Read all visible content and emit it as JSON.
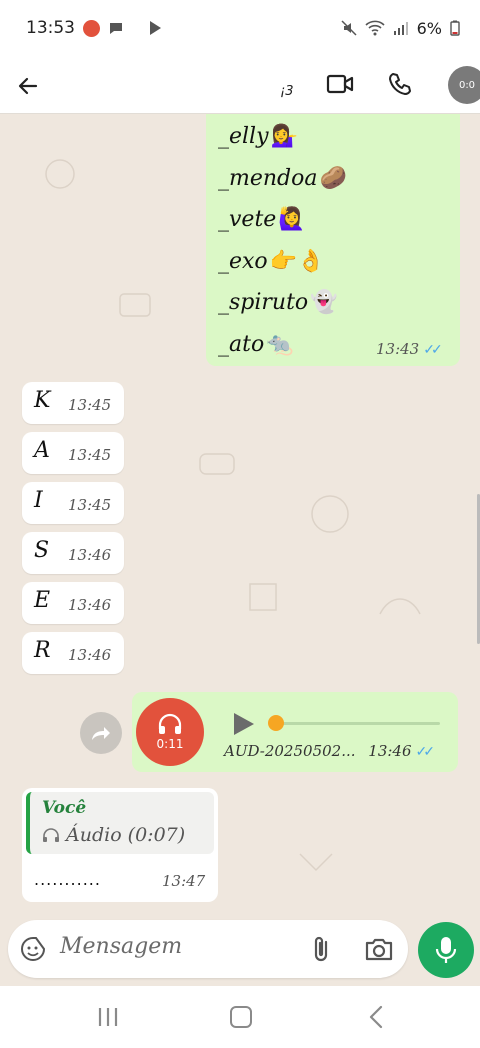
{
  "status_bar": {
    "time": "13:53",
    "battery": "6%"
  },
  "header": {
    "subtitle": "¡3",
    "call_timer": "0:0"
  },
  "messages": {
    "outgoing_list": {
      "lines": [
        {
          "text": "_elly",
          "emoji": "💁‍♀️"
        },
        {
          "text": "_mendoa",
          "emoji": "🥔"
        },
        {
          "text": "_vete",
          "emoji": "🙋‍♀️"
        },
        {
          "text": "_exo",
          "emoji": "👉👌"
        },
        {
          "text": "_spiruto",
          "emoji": "👻"
        },
        {
          "text": "_ato",
          "emoji": "🐀"
        }
      ],
      "time": "13:43",
      "ticks": "✓✓"
    },
    "incoming_letters": [
      {
        "letter": "K",
        "time": "13:45"
      },
      {
        "letter": "A",
        "time": "13:45"
      },
      {
        "letter": "I",
        "time": "13:45"
      },
      {
        "letter": "S",
        "time": "13:46"
      },
      {
        "letter": "E",
        "time": "13:46"
      },
      {
        "letter": "R",
        "time": "13:46"
      }
    ],
    "audio": {
      "duration": "0:11",
      "progress": 0.0,
      "filename": "AUD-20250502...",
      "time": "13:46",
      "ticks": "✓✓"
    },
    "reply": {
      "quoted_name": "Você",
      "quoted_content": "Áudio (0:07)",
      "text": "...........",
      "time": "13:47"
    }
  },
  "composer": {
    "placeholder": "Mensagem"
  },
  "colors": {
    "outgoing_bubble": "#dbf8c6",
    "incoming_bubble": "#ffffff",
    "accent_green": "#1daa61",
    "read_ticks": "#4fa8e8",
    "audio_avatar": "#e2523c"
  }
}
